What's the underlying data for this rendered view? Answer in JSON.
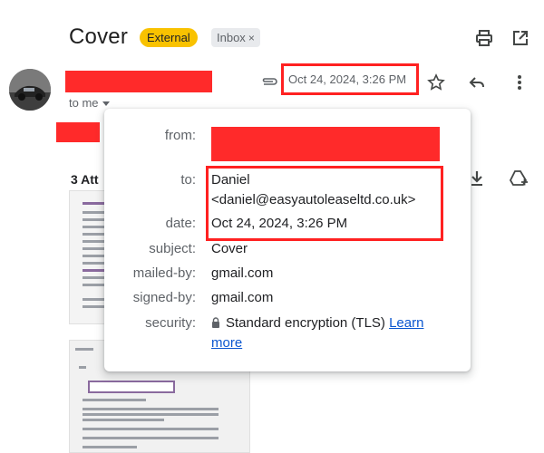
{
  "header": {
    "subject": "Cover",
    "badge_external": "External",
    "badge_inbox": "Inbox",
    "badge_inbox_close": "×"
  },
  "message": {
    "date": "Oct 24, 2024, 3:26 PM",
    "to_me": "to me"
  },
  "attachments": {
    "label": "3 Att"
  },
  "details": {
    "from_label": "from:",
    "to_label": "to:",
    "to_name": "Daniel",
    "to_email": "<daniel@easyautoleaseltd.co.uk>",
    "date_label": "date:",
    "date_value": "Oct 24, 2024, 3:26 PM",
    "subject_label": "subject:",
    "subject_value": "Cover",
    "mailed_by_label": "mailed-by:",
    "mailed_by_value": "gmail.com",
    "signed_by_label": "signed-by:",
    "signed_by_value": "gmail.com",
    "security_label": "security:",
    "security_value": "Standard encryption (TLS)",
    "learn_more_1": "Learn",
    "learn_more_2": "more"
  },
  "icons": [
    "print-icon",
    "open-in-new-icon",
    "paperclip-icon",
    "star-icon",
    "reply-icon",
    "more-vert-icon",
    "download-icon",
    "add-to-drive-icon",
    "lock-icon",
    "caret-down-icon"
  ],
  "colors": {
    "external_badge": "#f9c200",
    "inbox_badge": "#e8eaed",
    "redaction": "#ff2a2a",
    "highlight_box": "#ff2121",
    "link": "#0b57d0"
  }
}
